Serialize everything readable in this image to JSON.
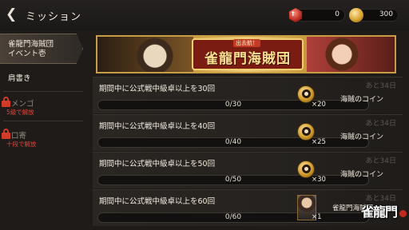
{
  "header": {
    "back_icon": "chevron-left-icon",
    "title": "ミッション",
    "currencies": [
      {
        "icon": "red-gem-icon",
        "icon_text": "†",
        "value": "0"
      },
      {
        "icon": "gold-coin-icon",
        "value": "300"
      }
    ]
  },
  "sidebar": {
    "items": [
      {
        "label": "雀龍門海賊団\nイベント壱",
        "active": true
      },
      {
        "label": "肩書き"
      },
      {
        "label": "メンゴ",
        "locked": true,
        "lock_note": "5級で解放"
      },
      {
        "label": "口寄",
        "locked": true,
        "lock_note": "十段で解放"
      }
    ]
  },
  "banner": {
    "subtitle": "出去航！",
    "title": "雀龍門海賊団"
  },
  "missions": [
    {
      "text": "期間中に公式戦中級卓以上を30回",
      "progress": "0/30",
      "fraction": 0,
      "days": "あと34日",
      "reward_icon": "pirate-coin-icon",
      "qty": "×20",
      "reward": "海賊のコイン"
    },
    {
      "text": "期間中に公式戦中級卓以上を40回",
      "progress": "0/40",
      "fraction": 0,
      "days": "あと34日",
      "reward_icon": "pirate-coin-icon",
      "qty": "×25",
      "reward": "海賊のコイン"
    },
    {
      "text": "期間中に公式戦中級卓以上を50回",
      "progress": "0/50",
      "fraction": 0,
      "days": "あと34日",
      "reward_icon": "pirate-coin-icon",
      "qty": "×30",
      "reward": "海賊のコイン"
    },
    {
      "text": "期間中に公式戦中級卓以上を60回",
      "progress": "0/60",
      "fraction": 0,
      "days": "あと34日",
      "reward_icon": "character-portrait-icon",
      "qty": "×1",
      "reward": "雀龍門海賊団"
    }
  ],
  "logo": {
    "text": "雀龍門"
  },
  "colors": {
    "accent_gold": "#c89b45",
    "lock_red": "#d23a2a",
    "background": "#1e1b19"
  }
}
